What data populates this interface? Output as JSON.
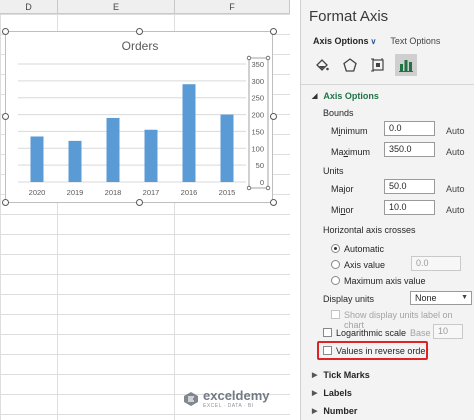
{
  "sheet": {
    "columns": [
      "D",
      "E",
      "F"
    ]
  },
  "chart_data": {
    "type": "bar",
    "title": "Orders",
    "categories": [
      "2020",
      "2019",
      "2018",
      "2017",
      "2016",
      "2015"
    ],
    "values": [
      135,
      122,
      190,
      155,
      290,
      200
    ],
    "ylim": [
      0,
      350
    ],
    "yticks": [
      "0",
      "50",
      "100",
      "150",
      "200",
      "250",
      "300",
      "350"
    ],
    "axis_position": "right",
    "grid": true,
    "colors": {
      "bar": "#5b9bd5",
      "grid": "#d9d9d9",
      "title": "#595959"
    }
  },
  "pane": {
    "title": "Format Axis",
    "tab_axis_options": "Axis Options",
    "tab_text_options": "Text Options",
    "icons": [
      "fill-line-icon",
      "effects-icon",
      "size-properties-icon",
      "axis-options-icon"
    ],
    "section_axis_options": "Axis Options",
    "bounds_label": "Bounds",
    "minimum_label": "Minimum",
    "minimum_value": "0.0",
    "maximum_label": "Maximum",
    "maximum_value": "350.0",
    "units_label": "Units",
    "major_label": "Major",
    "major_value": "50.0",
    "minor_label": "Minor",
    "minor_value": "10.0",
    "auto_label": "Auto",
    "h_axis_crosses_label": "Horizontal axis crosses",
    "radio_automatic": "Automatic",
    "radio_axis_value": "Axis value",
    "axis_value_value": "0.0",
    "radio_max_axis_value": "Maximum axis value",
    "display_units_label": "Display units",
    "display_units_value": "None",
    "show_units_label": "Show display units label on chart",
    "log_scale_label": "Logarithmic scale",
    "base_label": "Base",
    "base_value": "10",
    "reverse_order_label": "Values in reverse order",
    "tick_marks_label": "Tick Marks",
    "labels_label": "Labels",
    "number_label": "Number",
    "accent_color": "#217346"
  },
  "watermark": {
    "name": "exceldemy",
    "tagline": "EXCEL · DATA · BI"
  }
}
